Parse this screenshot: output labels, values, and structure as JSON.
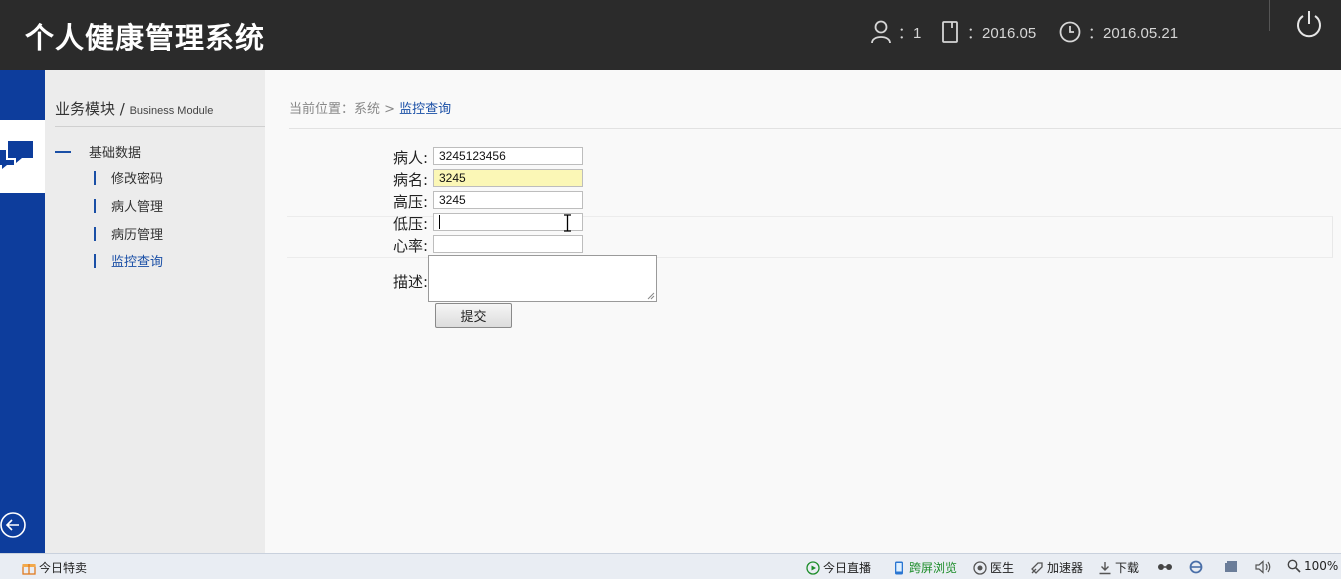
{
  "header": {
    "app_title": "个人健康管理系统",
    "user_count": "：1",
    "month": "：2016.05",
    "date": "：2016.05.21"
  },
  "sidebar": {
    "module_title": "业务模块 / ",
    "module_subtitle": "Business Module",
    "group_label": "基础数据",
    "items": [
      {
        "label": "修改密码"
      },
      {
        "label": "病人管理"
      },
      {
        "label": "病历管理"
      },
      {
        "label": "监控查询"
      }
    ]
  },
  "breadcrumb": {
    "prefix": "当前位置：系统 > ",
    "current": "监控查询"
  },
  "form": {
    "patient_label": "病人:",
    "patient_value": "3245123456",
    "disease_label": "病名:",
    "disease_value": "3245",
    "high_bp_label": "高压:",
    "high_bp_value": "3245",
    "low_bp_label": "低压:",
    "low_bp_value": "",
    "heart_rate_label": "心率:",
    "heart_rate_value": "",
    "description_label": "描述:",
    "submit_label": "提交"
  },
  "statusbar": {
    "deals": "今日特卖",
    "live": "今日直播",
    "cross_screen": "跨屏浏览",
    "doctor": "医生",
    "accelerator": "加速器",
    "download": "下载",
    "zoom": "100%"
  },
  "colors": {
    "topbar": "#2b2b2b",
    "rail": "#0d3d9c",
    "accent": "#1a4fa6",
    "highlight_input": "#fbf7b6"
  }
}
